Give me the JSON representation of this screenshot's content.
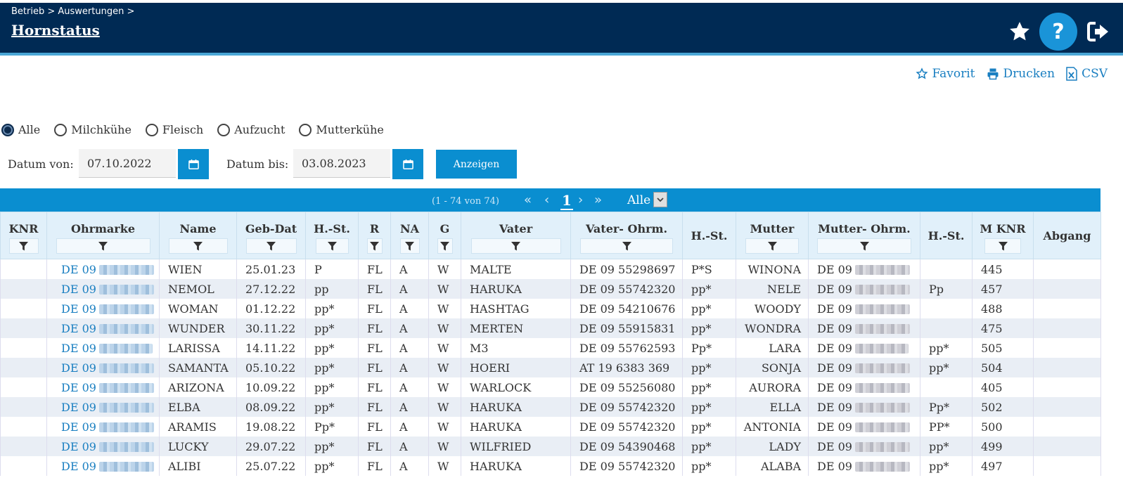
{
  "header": {
    "breadcrumb": "Betrieb > Auswertungen >",
    "title": "Hornstatus",
    "icons": [
      "star-icon",
      "help-icon",
      "logout-icon"
    ]
  },
  "actions": {
    "favorit": "Favorit",
    "drucken": "Drucken",
    "csv": "CSV"
  },
  "filters": {
    "options": [
      "Alle",
      "Milchkühe",
      "Fleisch",
      "Aufzucht",
      "Mutterkühe"
    ],
    "selected": "Alle"
  },
  "dates": {
    "from_label": "Datum von:",
    "from_value": "07.10.2022",
    "to_label": "Datum bis:",
    "to_value": "03.08.2023",
    "show_button": "Anzeigen"
  },
  "pager": {
    "info": "(1 - 74 von 74)",
    "first": "«",
    "prev": "‹",
    "current": "1",
    "next": "›",
    "last": "»",
    "page_size": "Alle"
  },
  "table": {
    "columns": [
      "KNR",
      "Ohrmarke",
      "Name",
      "Geb-Dat",
      "H.-St.",
      "R",
      "NA",
      "G",
      "Vater",
      "Vater- Ohrm.",
      "H.-St.",
      "Mutter",
      "Mutter- Ohrm.",
      "H.-St.",
      "M KNR",
      "Abgang"
    ],
    "rows": [
      {
        "knr": "",
        "ohrmarke": "DE 09",
        "name": "WIEN",
        "geb": "25.01.23",
        "hst": "P",
        "r": "FL",
        "na": "A",
        "g": "W",
        "vater": "MALTE",
        "vohrm": "DE 09 55298697",
        "vhst": "P*S",
        "mutter": "WINONA",
        "mohrm": "DE 09",
        "mhst": "",
        "mknr": "445",
        "abgang": ""
      },
      {
        "knr": "",
        "ohrmarke": "DE 09",
        "name": "NEMOL",
        "geb": "27.12.22",
        "hst": "pp",
        "r": "FL",
        "na": "A",
        "g": "W",
        "vater": "HARUKA",
        "vohrm": "DE 09 55742320",
        "vhst": "pp*",
        "mutter": "NELE",
        "mohrm": "DE 09",
        "mhst": "Pp",
        "mknr": "457",
        "abgang": ""
      },
      {
        "knr": "",
        "ohrmarke": "DE 09",
        "name": "WOMAN",
        "geb": "01.12.22",
        "hst": "pp*",
        "r": "FL",
        "na": "A",
        "g": "W",
        "vater": "HASHTAG",
        "vohrm": "DE 09 54210676",
        "vhst": "pp*",
        "mutter": "WOODY",
        "mohrm": "DE 09",
        "mhst": "",
        "mknr": "488",
        "abgang": ""
      },
      {
        "knr": "",
        "ohrmarke": "DE 09",
        "name": "WUNDER",
        "geb": "30.11.22",
        "hst": "pp*",
        "r": "FL",
        "na": "A",
        "g": "W",
        "vater": "MERTEN",
        "vohrm": "DE 09 55915831",
        "vhst": "pp*",
        "mutter": "WONDRA",
        "mohrm": "DE 09",
        "mhst": "",
        "mknr": "475",
        "abgang": ""
      },
      {
        "knr": "",
        "ohrmarke": "DE 09",
        "name": "LARISSA",
        "geb": "14.11.22",
        "hst": "pp*",
        "r": "FL",
        "na": "A",
        "g": "W",
        "vater": "M3",
        "vohrm": "DE 09 55762593",
        "vhst": "Pp*",
        "mutter": "LARA",
        "mohrm": "DE 09",
        "mhst": "pp*",
        "mknr": "505",
        "abgang": ""
      },
      {
        "knr": "",
        "ohrmarke": "DE 09",
        "name": "SAMANTA",
        "geb": "05.10.22",
        "hst": "pp*",
        "r": "FL",
        "na": "A",
        "g": "W",
        "vater": "HOERI",
        "vohrm": "AT 19 6383 369",
        "vhst": "pp*",
        "mutter": "SONJA",
        "mohrm": "DE 09",
        "mhst": "pp*",
        "mknr": "504",
        "abgang": ""
      },
      {
        "knr": "",
        "ohrmarke": "DE 09",
        "name": "ARIZONA",
        "geb": "10.09.22",
        "hst": "pp*",
        "r": "FL",
        "na": "A",
        "g": "W",
        "vater": "WARLOCK",
        "vohrm": "DE 09 55256080",
        "vhst": "pp*",
        "mutter": "AURORA",
        "mohrm": "DE 09",
        "mhst": "",
        "mknr": "405",
        "abgang": ""
      },
      {
        "knr": "",
        "ohrmarke": "DE 09",
        "name": "ELBA",
        "geb": "08.09.22",
        "hst": "pp*",
        "r": "FL",
        "na": "A",
        "g": "W",
        "vater": "HARUKA",
        "vohrm": "DE 09 55742320",
        "vhst": "pp*",
        "mutter": "ELLA",
        "mohrm": "DE 09",
        "mhst": "Pp*",
        "mknr": "502",
        "abgang": ""
      },
      {
        "knr": "",
        "ohrmarke": "DE 09",
        "name": "ARAMIS",
        "geb": "19.08.22",
        "hst": "Pp*",
        "r": "FL",
        "na": "A",
        "g": "W",
        "vater": "HARUKA",
        "vohrm": "DE 09 55742320",
        "vhst": "pp*",
        "mutter": "ANTONIA",
        "mohrm": "DE 09",
        "mhst": "PP*",
        "mknr": "500",
        "abgang": ""
      },
      {
        "knr": "",
        "ohrmarke": "DE 09",
        "name": "LUCKY",
        "geb": "29.07.22",
        "hst": "pp*",
        "r": "FL",
        "na": "A",
        "g": "W",
        "vater": "WILFRIED",
        "vohrm": "DE 09 54390468",
        "vhst": "pp*",
        "mutter": "LADY",
        "mohrm": "DE 09",
        "mhst": "pp*",
        "mknr": "499",
        "abgang": ""
      },
      {
        "knr": "",
        "ohrmarke": "DE 09",
        "name": "ALIBI",
        "geb": "25.07.22",
        "hst": "pp*",
        "r": "FL",
        "na": "A",
        "g": "W",
        "vater": "HARUKA",
        "vohrm": "DE 09 55742320",
        "vhst": "pp*",
        "mutter": "ALABA",
        "mohrm": "DE 09",
        "mhst": "pp*",
        "mknr": "497",
        "abgang": ""
      }
    ]
  },
  "colors": {
    "header_bg": "#002a54",
    "accent": "#0a8ed0",
    "link": "#1a7fc1"
  }
}
